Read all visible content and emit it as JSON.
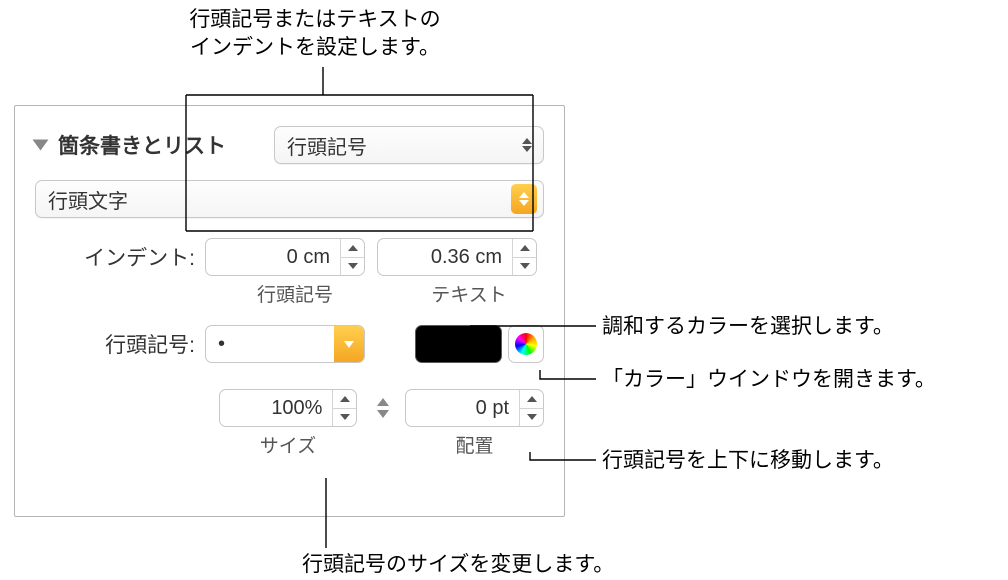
{
  "callouts": {
    "top": "行頭記号またはテキストの\nインデントを設定します。",
    "bottom": "行頭記号のサイズを変更します。",
    "right1": "調和するカラーを選択します。",
    "right2": "「カラー」ウインドウを開きます。",
    "right3": "行頭記号を上下に移動します。"
  },
  "section": {
    "title": "箇条書きとリスト",
    "style_popup": "行頭記号",
    "list_style": "行頭文字"
  },
  "indent": {
    "label": "インデント:",
    "bullet_value": "0 cm",
    "bullet_sub": "行頭記号",
    "text_value": "0.36 cm",
    "text_sub": "テキスト"
  },
  "bullet": {
    "label": "行頭記号:",
    "glyph": "•"
  },
  "size": {
    "value": "100%",
    "sub": "サイズ"
  },
  "align": {
    "value": "0 pt",
    "sub": "配置"
  }
}
